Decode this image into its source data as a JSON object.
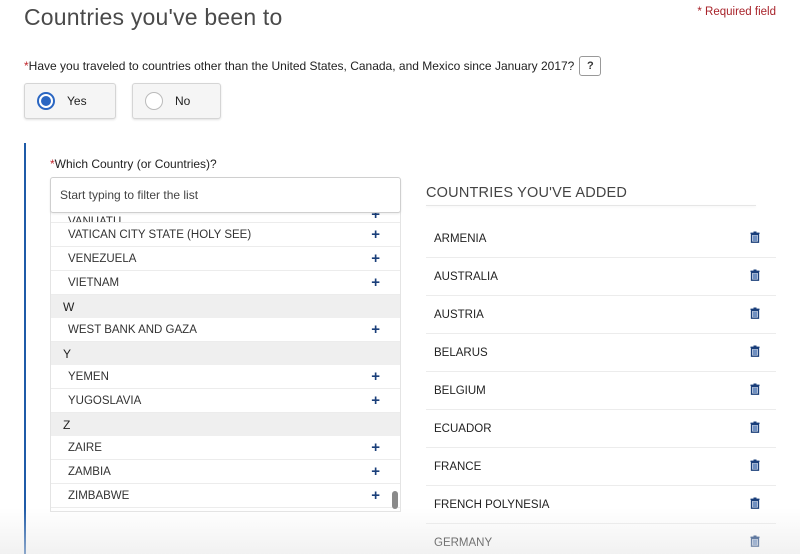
{
  "page": {
    "title": "Countries you've been to",
    "required_note": "* Required field"
  },
  "question": {
    "asterisk": "*",
    "text": "Have you traveled to countries other than the United States, Canada, and Mexico since January 2017?",
    "help_label": "?",
    "options": [
      {
        "label": "Yes",
        "selected": true
      },
      {
        "label": "No",
        "selected": false
      }
    ]
  },
  "country_picker": {
    "asterisk": "*",
    "label": "Which Country (or Countries)?",
    "filter_placeholder": "Start typing to filter the list",
    "filter_value": "",
    "rows": [
      {
        "type": "country",
        "name": "VANUATU",
        "partial": true
      },
      {
        "type": "country",
        "name": "VATICAN CITY STATE (HOLY SEE)"
      },
      {
        "type": "country",
        "name": "VENEZUELA"
      },
      {
        "type": "country",
        "name": "VIETNAM"
      },
      {
        "type": "letter",
        "name": "W"
      },
      {
        "type": "country",
        "name": "WEST BANK AND GAZA"
      },
      {
        "type": "letter",
        "name": "Y"
      },
      {
        "type": "country",
        "name": "YEMEN"
      },
      {
        "type": "country",
        "name": "YUGOSLAVIA"
      },
      {
        "type": "letter",
        "name": "Z"
      },
      {
        "type": "country",
        "name": "ZAIRE"
      },
      {
        "type": "country",
        "name": "ZAMBIA"
      },
      {
        "type": "country",
        "name": "ZIMBABWE"
      }
    ],
    "add_icon": "plus-icon"
  },
  "added": {
    "header": "COUNTRIES YOU'VE ADDED",
    "countries": [
      "ARMENIA",
      "AUSTRALIA",
      "AUSTRIA",
      "BELARUS",
      "BELGIUM",
      "ECUADOR",
      "FRANCE",
      "FRENCH POLYNESIA",
      "GERMANY"
    ],
    "remove_icon": "trash-icon"
  },
  "colors": {
    "accent_blue": "#1f5ba8",
    "radio_blue": "#2a66c2",
    "icon_navy": "#1a3f7a",
    "required_red": "#a8232a"
  }
}
